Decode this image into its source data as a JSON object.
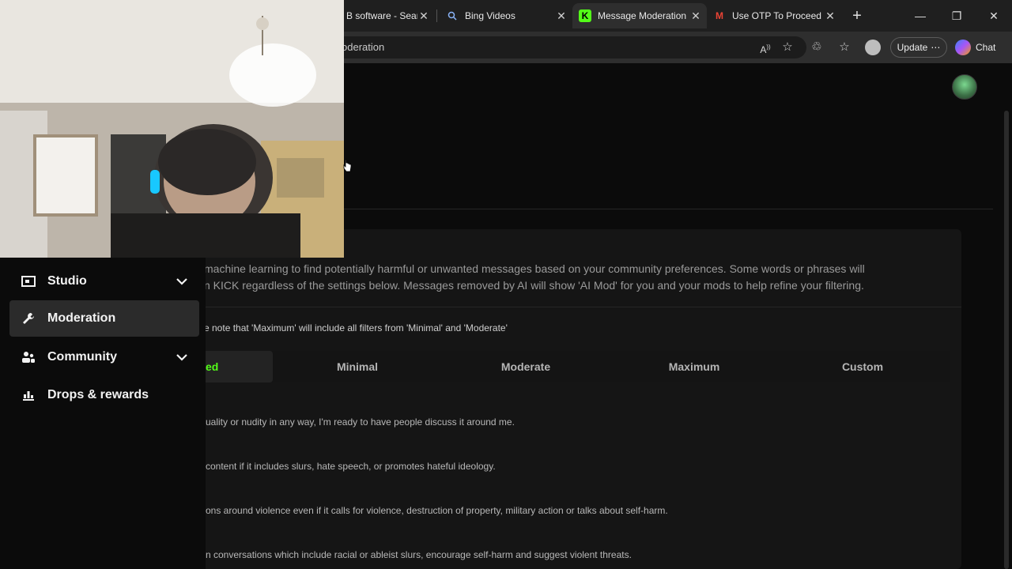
{
  "browser": {
    "tabs": [
      {
        "title": "B software - Searc",
        "icon": "search-icon"
      },
      {
        "title": "Bing Videos",
        "icon": "search-icon"
      },
      {
        "title": "Message Moderation",
        "icon": "kick-icon",
        "active": true
      },
      {
        "title": "Use OTP To Proceed",
        "icon": "gmail-icon"
      }
    ],
    "url": "oderation",
    "update_label": "Update",
    "chat_label": "Chat",
    "accent": "#53fc18"
  },
  "sidebar": {
    "items": [
      {
        "label": "Studio",
        "icon": "studio-icon",
        "expandable": true
      },
      {
        "label": "Moderation",
        "icon": "wrench-icon",
        "active": true
      },
      {
        "label": "Community",
        "icon": "community-icon",
        "expandable": true
      },
      {
        "label": "Drops & rewards",
        "icon": "drops-icon"
      }
    ]
  },
  "moderation": {
    "description_line1": "machine learning to find potentially harmful or unwanted messages based on your community preferences. Some words or phrases will",
    "description_line2": "n KICK regardless of the settings below. Messages removed by AI will show 'AI Mod' for you and your mods to help refine your filtering.",
    "note": "e note that 'Maximum' will include all filters from 'Minimal' and 'Moderate'",
    "levels": [
      "ed",
      "Minimal",
      "Moderate",
      "Maximum",
      "Custom"
    ],
    "options": [
      "uality or nudity in any way, I'm ready to have people discuss it around me.",
      "content if it includes slurs, hate speech, or promotes hateful ideology.",
      "ons around violence even if it calls for violence, destruction of property, military action or talks about self-harm.",
      "n conversations which include racial or ableist slurs, encourage self-harm and suggest violent threats."
    ]
  }
}
